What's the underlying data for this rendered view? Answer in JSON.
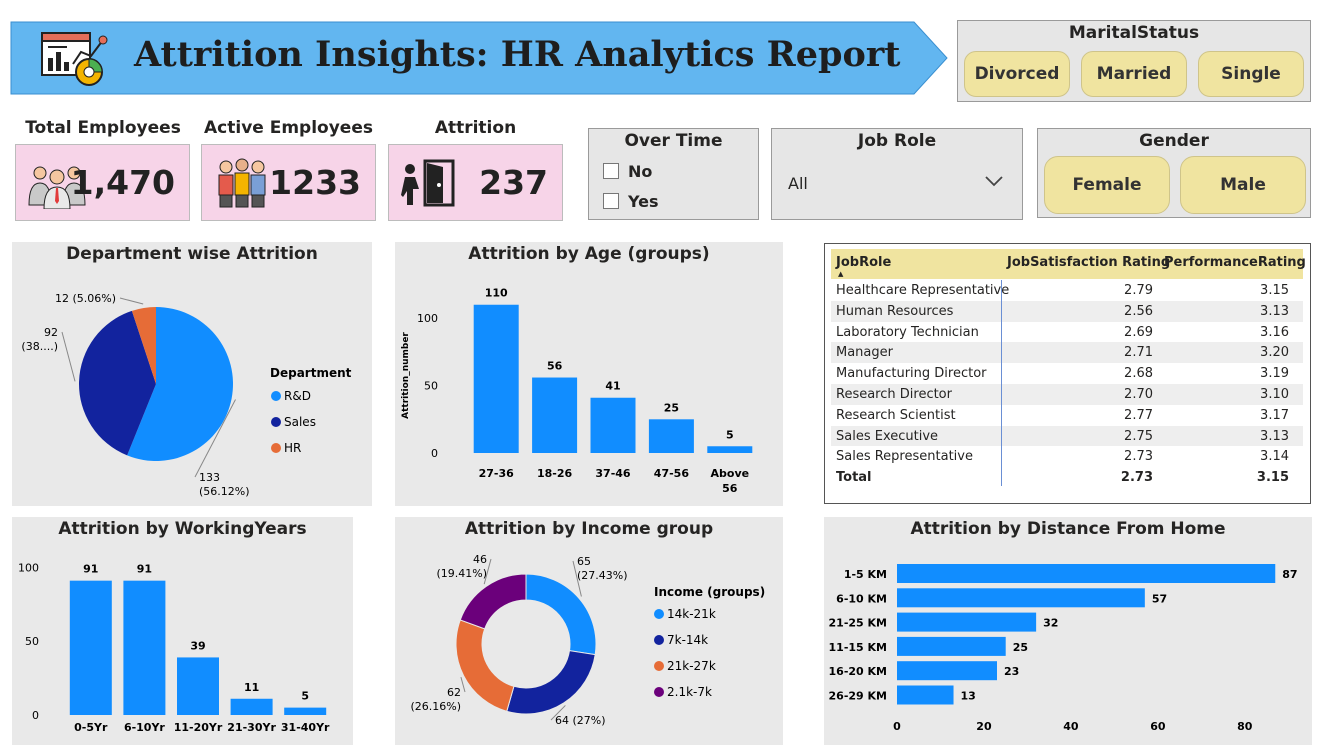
{
  "header": {
    "title": "Attrition Insights: HR Analytics Report"
  },
  "marital": {
    "title": "MaritalStatus",
    "options": [
      "Divorced",
      "Married",
      "Single"
    ]
  },
  "kpis": {
    "total": {
      "label": "Total Employees",
      "value": "1,470"
    },
    "active": {
      "label": "Active Employees",
      "value": "1233"
    },
    "attrition": {
      "label": "Attrition",
      "value": "237"
    }
  },
  "overtime": {
    "title": "Over Time",
    "options": [
      "No",
      "Yes"
    ]
  },
  "jobrole": {
    "title": "Job Role",
    "value": "All"
  },
  "gender": {
    "title": "Gender",
    "options": [
      "Female",
      "Male"
    ]
  },
  "table": {
    "headers": [
      "JobRole",
      "JobSatisfaction Rating",
      "PerformanceRating"
    ],
    "rows": [
      [
        "Healthcare Representative",
        "2.79",
        "3.15"
      ],
      [
        "Human Resources",
        "2.56",
        "3.13"
      ],
      [
        "Laboratory Technician",
        "2.69",
        "3.16"
      ],
      [
        "Manager",
        "2.71",
        "3.20"
      ],
      [
        "Manufacturing Director",
        "2.68",
        "3.19"
      ],
      [
        "Research Director",
        "2.70",
        "3.10"
      ],
      [
        "Research Scientist",
        "2.77",
        "3.17"
      ],
      [
        "Sales Executive",
        "2.75",
        "3.13"
      ],
      [
        "Sales Representative",
        "2.73",
        "3.14"
      ]
    ],
    "total": [
      "Total",
      "2.73",
      "3.15"
    ]
  },
  "chart_data": [
    {
      "type": "pie",
      "title": "Department wise Attrition",
      "legend_title": "Department",
      "categories": [
        "R&D",
        "Sales",
        "HR"
      ],
      "values": [
        133,
        92,
        12
      ],
      "labels": [
        "133\n(56.12%)",
        "92\n(38....)",
        "12 (5.06%)"
      ],
      "colors": [
        "#118DFF",
        "#12239E",
        "#E66C37"
      ],
      "legend_position": "right"
    },
    {
      "type": "bar",
      "title": "Attrition by Age (groups)",
      "ylabel": "Attrition_number",
      "categories": [
        "27-36",
        "18-26",
        "37-46",
        "47-56",
        "Above 56"
      ],
      "values": [
        110,
        56,
        41,
        25,
        5
      ],
      "yticks": [
        0,
        50,
        100
      ],
      "color": "#118DFF"
    },
    {
      "type": "bar",
      "title": "Attrition by WorkingYears",
      "categories": [
        "0-5Yr",
        "6-10Yr",
        "11-20Yr",
        "21-30Yr",
        "31-40Yr"
      ],
      "values": [
        91,
        91,
        39,
        11,
        5
      ],
      "yticks": [
        0,
        50,
        100
      ],
      "color": "#118DFF"
    },
    {
      "type": "pie",
      "title": "Attrition by Income group",
      "legend_title": "Income (groups)",
      "categories": [
        "14k-21k",
        "7k-14k",
        "21k-27k",
        "2.1k-7k"
      ],
      "values": [
        65,
        64,
        62,
        46
      ],
      "labels": [
        "65\n(27.43%)",
        "64 (27%)",
        "62\n(26.16%)",
        "46\n(19.41%)"
      ],
      "colors": [
        "#118DFF",
        "#12239E",
        "#E66C37",
        "#6B007B"
      ],
      "donut": true,
      "legend_position": "right"
    },
    {
      "type": "bar",
      "orientation": "horizontal",
      "title": "Attrition by Distance From Home",
      "categories": [
        "1-5 KM",
        "6-10 KM",
        "21-25 KM",
        "11-15 KM",
        "16-20 KM",
        "26-29 KM"
      ],
      "values": [
        87,
        57,
        32,
        25,
        23,
        13
      ],
      "xticks": [
        0,
        20,
        40,
        60,
        80
      ],
      "color": "#118DFF"
    }
  ]
}
